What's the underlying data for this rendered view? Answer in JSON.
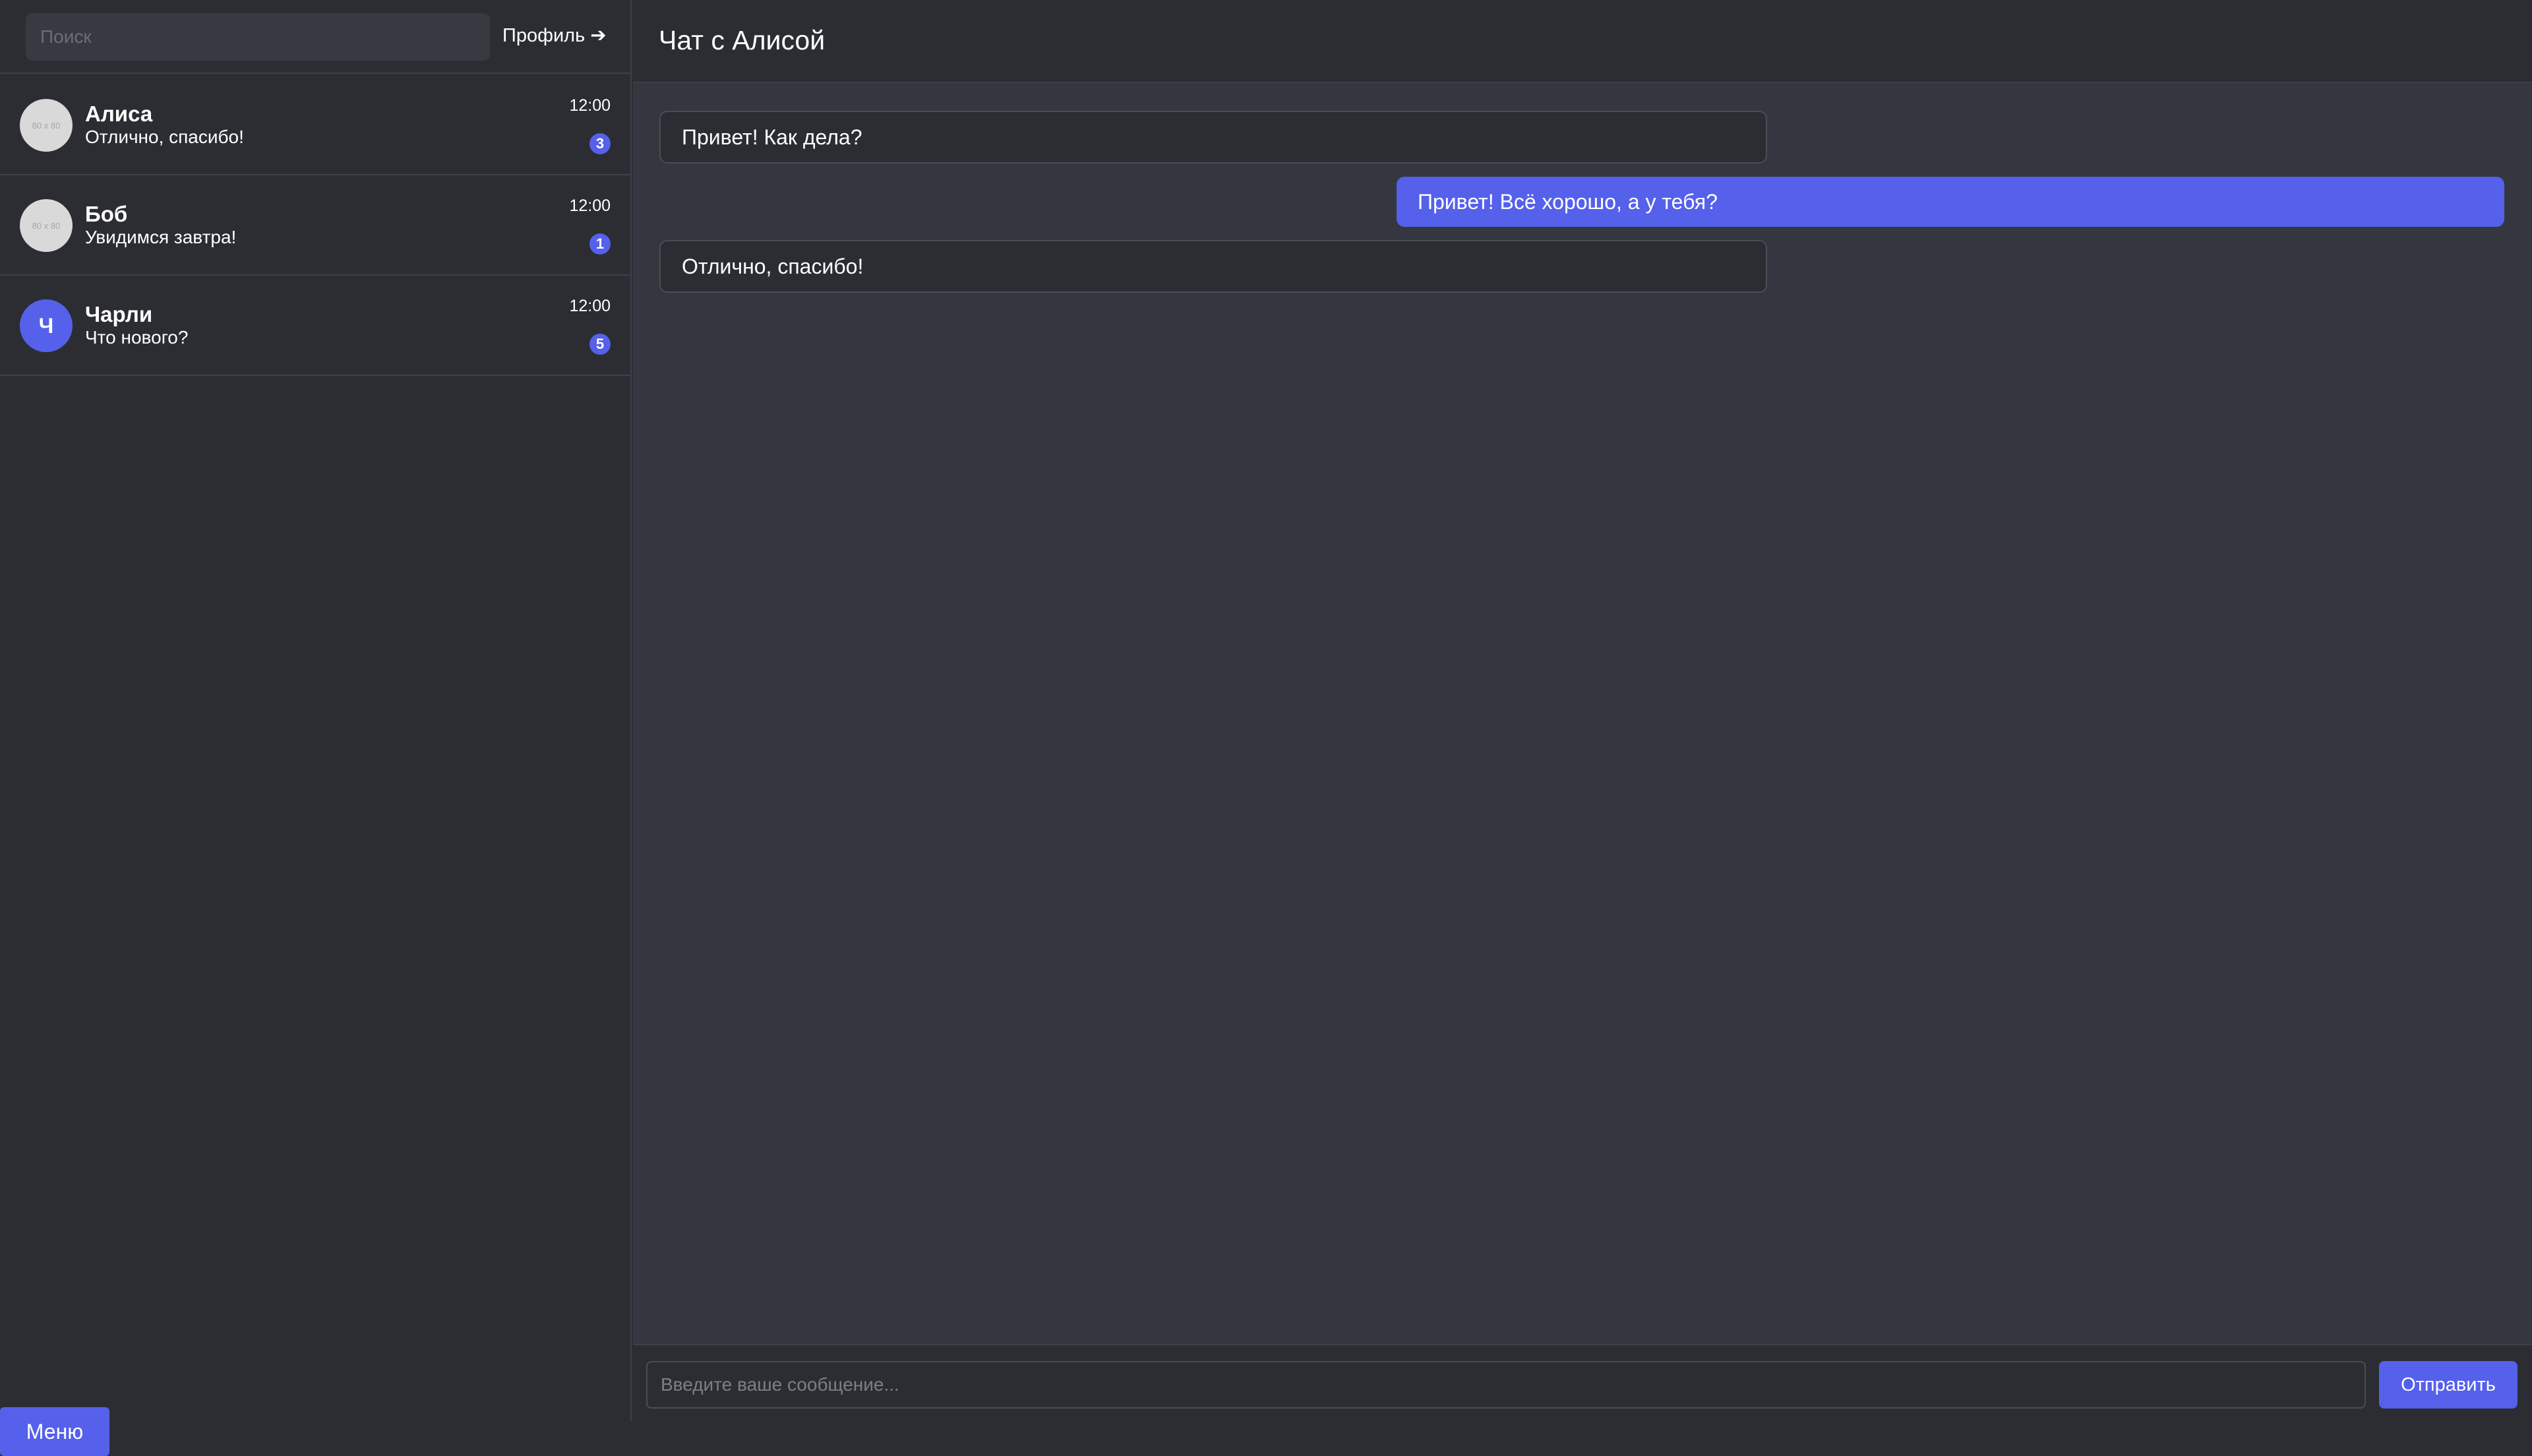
{
  "sidebar": {
    "search_placeholder": "Поиск",
    "profile_label": "Профиль ➔",
    "contacts": [
      {
        "name": "Алиса",
        "last_message": "Отлично, спасибо!",
        "time": "12:00",
        "unread": "3",
        "avatar_text": "80 x 80"
      },
      {
        "name": "Боб",
        "last_message": "Увидимся завтра!",
        "time": "12:00",
        "unread": "1",
        "avatar_text": "80 x 80"
      },
      {
        "name": "Чарли",
        "last_message": "Что нового?",
        "time": "12:00",
        "unread": "5",
        "avatar_text": "Ч"
      }
    ],
    "menu_label": "Меню"
  },
  "chat": {
    "title": "Чат с Алисой",
    "messages": [
      {
        "direction": "incoming",
        "text": "Привет! Как дела?"
      },
      {
        "direction": "outgoing",
        "text": "Привет! Всё хорошо, а у тебя?"
      },
      {
        "direction": "incoming",
        "text": "Отлично, спасибо!"
      }
    ],
    "input_placeholder": "Введите ваше сообщение...",
    "send_label": "Отправить"
  },
  "colors": {
    "accent": "#5561ea",
    "background": "#2b2d33",
    "chat_background": "#353740"
  }
}
